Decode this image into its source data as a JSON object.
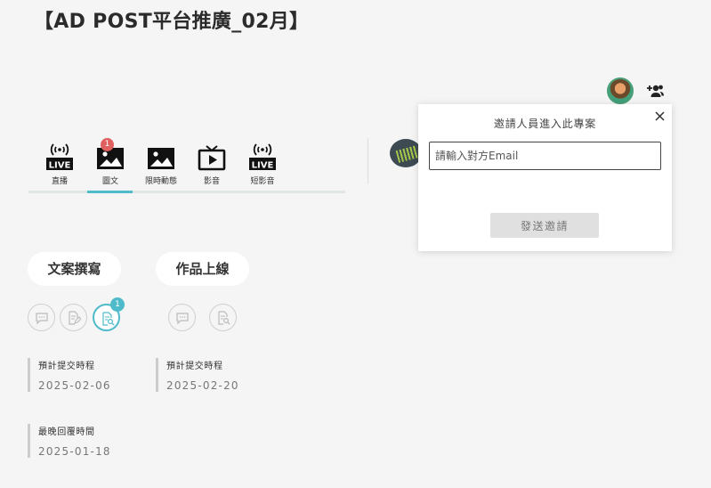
{
  "page_title": "【AD POST平台推廣_02月】",
  "channels": [
    {
      "label": "直播",
      "icon": "live-icon",
      "icon_text": "LIVE"
    },
    {
      "label": "圖文",
      "icon": "image-icon",
      "badge": "1"
    },
    {
      "label": "限時動態",
      "icon": "image-icon"
    },
    {
      "label": "影音",
      "icon": "tv-play-icon"
    },
    {
      "label": "短影音",
      "icon": "live-icon",
      "icon_text": "LIVE"
    }
  ],
  "stages": [
    {
      "label": "文案撰寫",
      "badge": "1",
      "dates": [
        {
          "label": "預計提交時程",
          "value": "2025-02-06"
        },
        {
          "label": "最晚回覆時間",
          "value": "2025-01-18"
        }
      ]
    },
    {
      "label": "作品上線",
      "dates": [
        {
          "label": "預計提交時程",
          "value": "2025-02-20"
        }
      ]
    }
  ],
  "invite": {
    "title": "邀請人員進入此專案",
    "email_placeholder": "請輸入對方Email",
    "send_label": "發送邀請"
  },
  "colors": {
    "accent": "#4fbac9",
    "badge_red": "#e06060",
    "background": "#f5f5f5"
  }
}
